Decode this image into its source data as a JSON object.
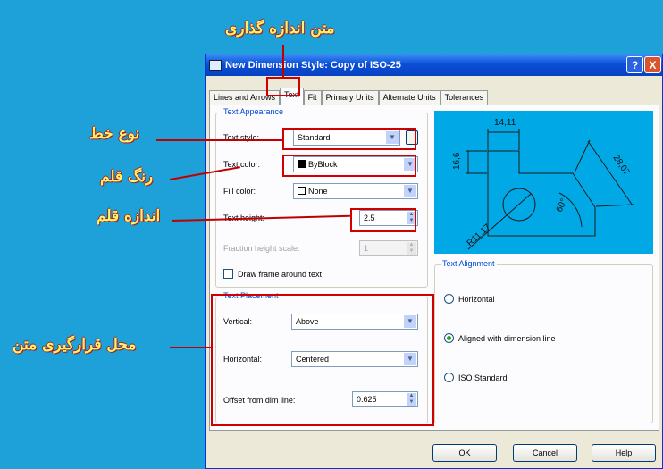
{
  "annotations": {
    "title": "متن اندازه گذاری",
    "font_type": "نوع خط",
    "pen_color": "رنگ قلم",
    "pen_size": "اندازه قلم",
    "text_placement": "محل قرارگیری متن"
  },
  "window": {
    "title": "New Dimension Style: Copy of ISO-25",
    "help_label": "?",
    "close_label": "X"
  },
  "tabs": [
    "Lines and Arrows",
    "Text",
    "Fit",
    "Primary Units",
    "Alternate Units",
    "Tolerances"
  ],
  "text_appearance": {
    "title": "Text Appearance",
    "style_label": "Text style:",
    "style_value": "Standard",
    "browse_label": "...",
    "color_label": "Text color:",
    "color_value": "ByBlock",
    "fill_label": "Fill color:",
    "fill_value": "None",
    "height_label": "Text height:",
    "height_value": "2.5",
    "fraction_label": "Fraction height scale:",
    "fraction_value": "1",
    "frame_label": "Draw frame around text"
  },
  "text_placement": {
    "title": "Text Placement",
    "vertical_label": "Vertical:",
    "vertical_value": "Above",
    "horizontal_label": "Horizontal:",
    "horizontal_value": "Centered",
    "offset_label": "Offset from dim line:",
    "offset_value": "0.625"
  },
  "text_alignment": {
    "title": "Text Alignment",
    "options": [
      "Horizontal",
      "Aligned with dimension line",
      "ISO Standard"
    ],
    "selected": "Aligned with dimension line"
  },
  "preview": {
    "dim_top": "14,11",
    "dim_left": "16,6",
    "dim_right": "28,07",
    "dim_angle": "60°",
    "dim_radius": "R11,17"
  },
  "buttons": {
    "ok": "OK",
    "cancel": "Cancel",
    "help": "Help"
  },
  "colors": {
    "annotation": "#fff36b",
    "highlight_box": "#d00000",
    "background": "#1ea0d8"
  }
}
